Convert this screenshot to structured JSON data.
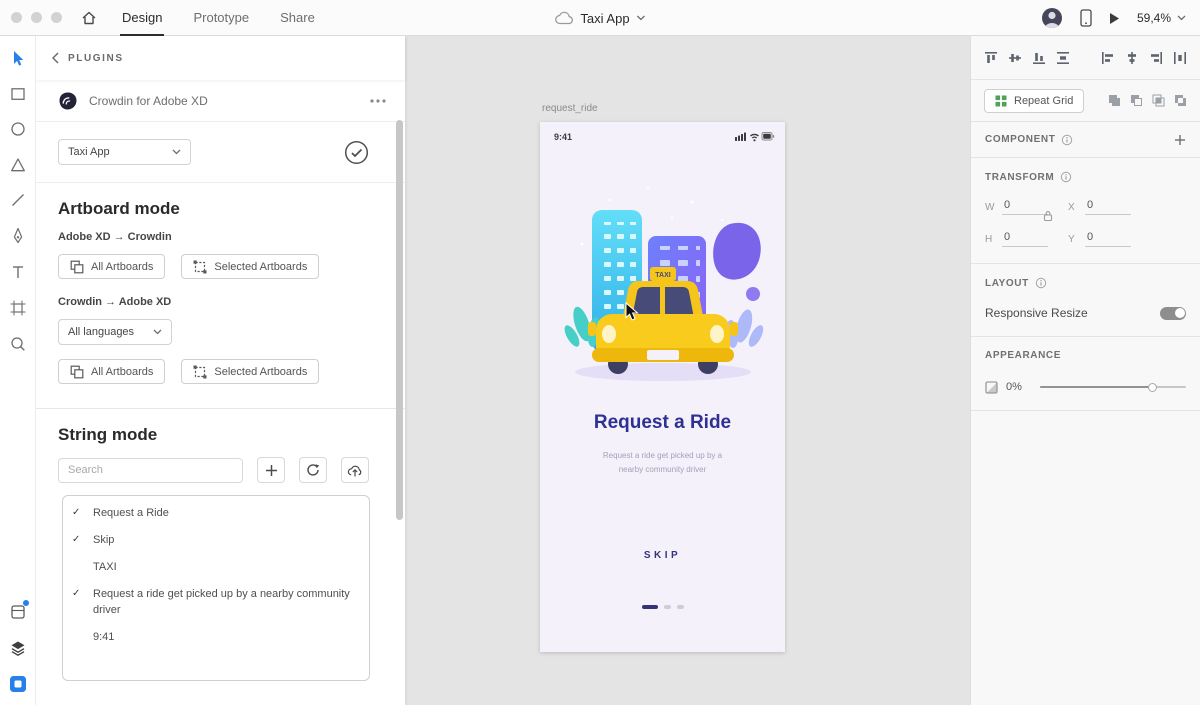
{
  "icons": {
    "check": "✓"
  },
  "colors": {
    "accent_blue": "#2680eb",
    "title_navy": "#2e3192",
    "taxi_yellow": "#f6c51a",
    "canvas_gray": "#e4e4e4"
  },
  "topbar": {
    "tabs": [
      {
        "label": "Design",
        "active": true
      },
      {
        "label": "Prototype",
        "active": false
      },
      {
        "label": "Share",
        "active": false
      }
    ],
    "document_title": "Taxi App",
    "zoom_level": "59,4%"
  },
  "plugins_panel": {
    "back_label": "PLUGINS",
    "plugin_title": "Crowdin for Adobe XD",
    "project_select_value": "Taxi App",
    "artboard_mode": {
      "heading": "Artboard mode",
      "direction_1": "Adobe XD → Crowdin",
      "direction_2": "Crowdin → Adobe XD",
      "all_artboards_label": "All Artboards",
      "selected_artboards_label": "Selected Artboards",
      "languages_select_value": "All languages"
    },
    "string_mode": {
      "heading": "String mode",
      "search_placeholder": "Search",
      "items": [
        {
          "label": "Request a Ride",
          "checked": true
        },
        {
          "label": "Skip",
          "checked": true
        },
        {
          "label": "TAXI",
          "checked": false
        },
        {
          "label": "Request a ride get picked up by a nearby community driver",
          "checked": true
        },
        {
          "label": "9:41",
          "checked": false
        }
      ]
    }
  },
  "canvas": {
    "artboard_name": "request_ride",
    "artboard": {
      "status_time": "9:41",
      "title": "Request a Ride",
      "subtitle_line1": "Request a ride get picked up by a",
      "subtitle_line2": "nearby community driver",
      "skip_label": "SKIP",
      "taxi_sign": "TAXI"
    }
  },
  "right_panel": {
    "repeat_grid_label": "Repeat Grid",
    "component_heading": "COMPONENT",
    "transform_heading": "TRANSFORM",
    "layout_heading": "LAYOUT",
    "appearance_heading": "APPEARANCE",
    "transform": {
      "w_label": "W",
      "x_label": "X",
      "h_label": "H",
      "y_label": "Y",
      "w": "0",
      "x": "0",
      "h": "0",
      "y": "0"
    },
    "responsive_resize_label": "Responsive Resize",
    "opacity_value": "0%"
  }
}
